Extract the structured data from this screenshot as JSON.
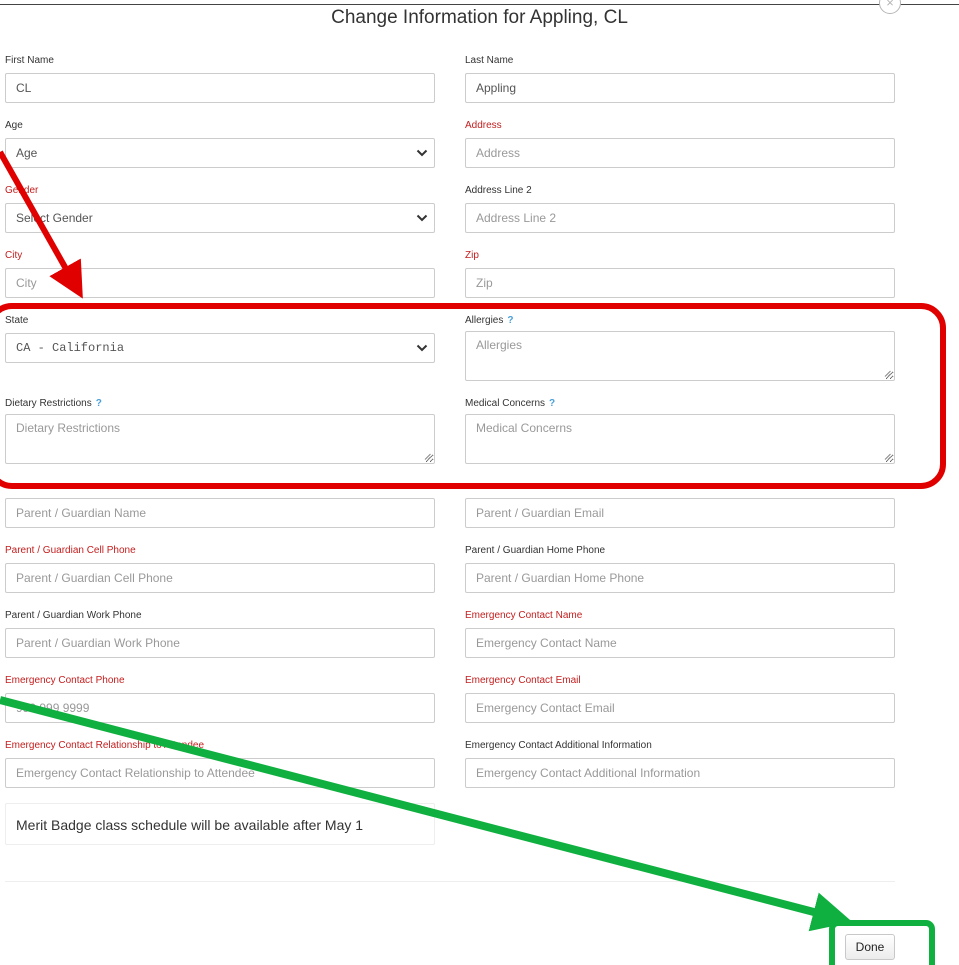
{
  "modal": {
    "title": "Change Information for Appling, CL",
    "close_symbol": "×"
  },
  "fields": {
    "first_name": {
      "label": "First Name",
      "value": "CL"
    },
    "last_name": {
      "label": "Last Name",
      "value": "Appling"
    },
    "age": {
      "label": "Age",
      "selected": "Age"
    },
    "address": {
      "label": "Address",
      "placeholder": "Address"
    },
    "gender": {
      "label": "Gender",
      "selected": "Select Gender"
    },
    "address2": {
      "label": "Address Line 2",
      "placeholder": "Address Line 2"
    },
    "city": {
      "label": "City",
      "placeholder": "City"
    },
    "zip": {
      "label": "Zip",
      "placeholder": "Zip"
    },
    "state": {
      "label": "State",
      "selected": "CA - California"
    },
    "allergies": {
      "label": "Allergies",
      "placeholder": "Allergies",
      "help": "?"
    },
    "dietary": {
      "label": "Dietary Restrictions",
      "placeholder": "Dietary Restrictions",
      "help": "?"
    },
    "medical": {
      "label": "Medical Concerns",
      "placeholder": "Medical Concerns",
      "help": "?"
    },
    "guardian_name": {
      "placeholder": "Parent / Guardian Name"
    },
    "guardian_email": {
      "placeholder": "Parent / Guardian Email"
    },
    "guardian_cell": {
      "label": "Parent / Guardian Cell Phone",
      "placeholder": "Parent / Guardian Cell Phone"
    },
    "guardian_home": {
      "label": "Parent / Guardian Home Phone",
      "placeholder": "Parent / Guardian Home Phone"
    },
    "guardian_work": {
      "label": "Parent / Guardian Work Phone",
      "placeholder": "Parent / Guardian Work Phone"
    },
    "emergency_name": {
      "label": "Emergency Contact Name",
      "placeholder": "Emergency Contact Name"
    },
    "emergency_phone": {
      "label": "Emergency Contact Phone",
      "placeholder": "999 999 9999"
    },
    "emergency_email": {
      "label": "Emergency Contact Email",
      "placeholder": "Emergency Contact Email"
    },
    "emergency_relationship": {
      "label": "Emergency Contact Relationship to Attendee",
      "placeholder": "Emergency Contact Relationship to Attendee"
    },
    "emergency_info": {
      "label": "Emergency Contact Additional Information",
      "placeholder": "Emergency Contact Additional Information"
    }
  },
  "notice": "Merit Badge class schedule will be available after May 1",
  "footer": {
    "done_label": "Done"
  },
  "colors": {
    "required_label": "#c41e1e",
    "help_icon": "#4a9fd8",
    "annotation_red": "#e00000",
    "annotation_green": "#10b040"
  },
  "icons": {
    "select_arrow": "chevron-down-icon",
    "textarea_grip": "resize-grip-icon",
    "close": "close-icon"
  }
}
